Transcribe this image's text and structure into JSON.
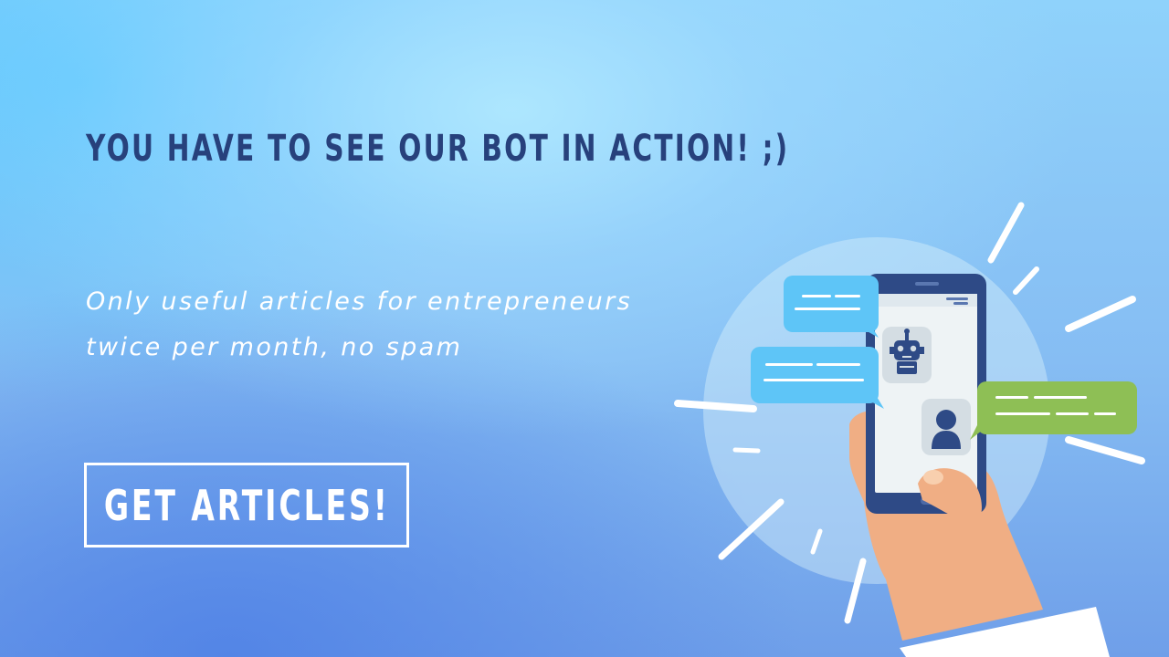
{
  "banner": {
    "headline": "YOU HAVE TO SEE OUR BOT IN ACTION! ;)",
    "subtext_line1": "Only useful articles for entrepreneurs",
    "subtext_line2": "twice per month, no spam",
    "cta_label": "GET ARTICLES!"
  },
  "illustration": {
    "icons": [
      "smartphone-icon",
      "robot-icon",
      "user-icon",
      "chat-bubble-icon",
      "hand-icon"
    ]
  },
  "colors": {
    "headline": "#27417c",
    "text": "#ffffff",
    "bubble_blue": "#5ec5f7",
    "bubble_green": "#8ebf55",
    "phone_frame": "#2e4a86",
    "skin": "#f0ae84"
  }
}
